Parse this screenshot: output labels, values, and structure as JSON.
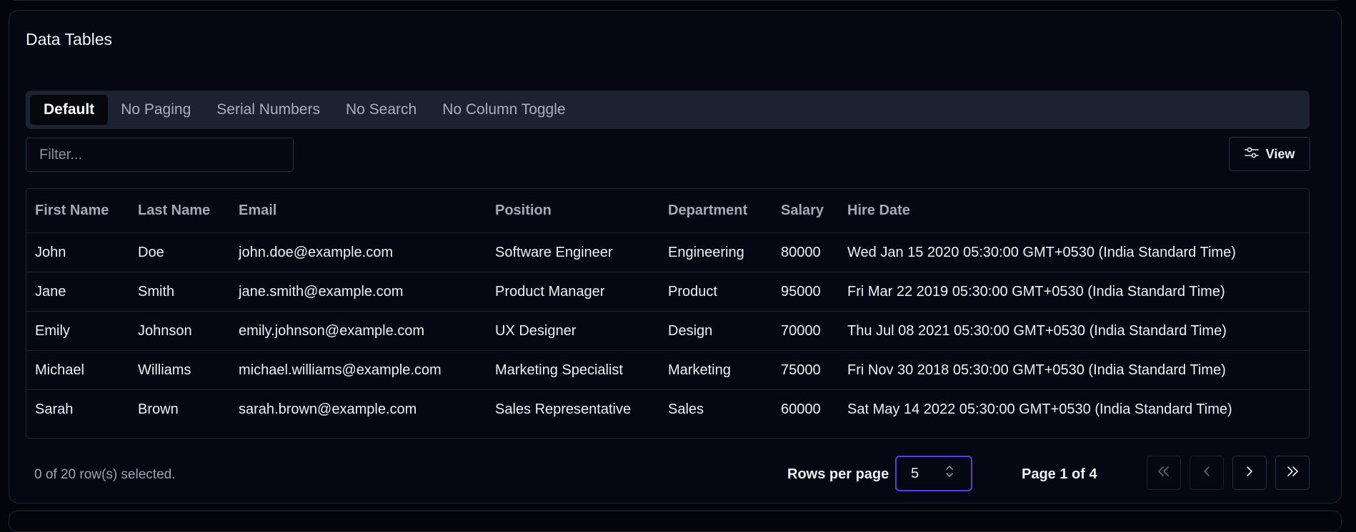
{
  "card": {
    "title": "Data Tables"
  },
  "tabs": [
    {
      "label": "Default",
      "active": true
    },
    {
      "label": "No Paging",
      "active": false
    },
    {
      "label": "Serial Numbers",
      "active": false
    },
    {
      "label": "No Search",
      "active": false
    },
    {
      "label": "No Column Toggle",
      "active": false
    }
  ],
  "toolbar": {
    "filter_placeholder": "Filter...",
    "filter_value": "",
    "view_label": "View",
    "view_icon": "sliders-icon"
  },
  "table": {
    "columns": [
      "First Name",
      "Last Name",
      "Email",
      "Position",
      "Department",
      "Salary",
      "Hire Date"
    ],
    "rows": [
      [
        "John",
        "Doe",
        "john.doe@example.com",
        "Software Engineer",
        "Engineering",
        "80000",
        "Wed Jan 15 2020 05:30:00 GMT+0530 (India Standard Time)"
      ],
      [
        "Jane",
        "Smith",
        "jane.smith@example.com",
        "Product Manager",
        "Product",
        "95000",
        "Fri Mar 22 2019 05:30:00 GMT+0530 (India Standard Time)"
      ],
      [
        "Emily",
        "Johnson",
        "emily.johnson@example.com",
        "UX Designer",
        "Design",
        "70000",
        "Thu Jul 08 2021 05:30:00 GMT+0530 (India Standard Time)"
      ],
      [
        "Michael",
        "Williams",
        "michael.williams@example.com",
        "Marketing Specialist",
        "Marketing",
        "75000",
        "Fri Nov 30 2018 05:30:00 GMT+0530 (India Standard Time)"
      ],
      [
        "Sarah",
        "Brown",
        "sarah.brown@example.com",
        "Sales Representative",
        "Sales",
        "60000",
        "Sat May 14 2022 05:30:00 GMT+0530 (India Standard Time)"
      ]
    ]
  },
  "footer": {
    "selected_text": "0 of 20 row(s) selected.",
    "rows_per_page_label": "Rows per page",
    "rows_per_page_value": "5",
    "page_info": "Page 1 of 4"
  },
  "colors": {
    "background": "#03050b",
    "card": "#050812",
    "tab_bar": "#1c2330",
    "border": "#1e2533",
    "select_focus": "#5b3fd6"
  }
}
